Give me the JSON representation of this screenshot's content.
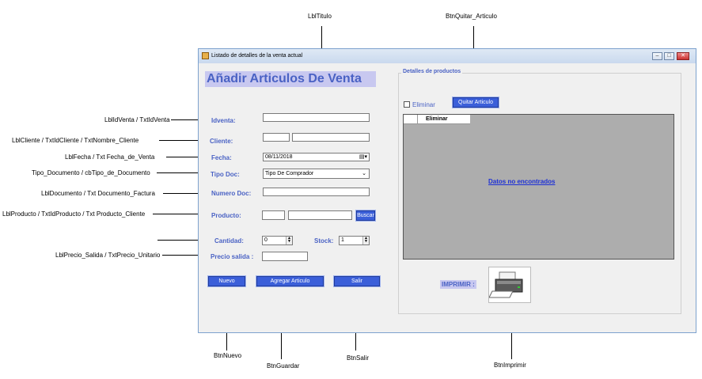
{
  "annotations": {
    "lbl_titulo": "LblTitulo",
    "btn_quitar_articulo": "BtnQuitar_Articulo",
    "idventa": "LblIdVenta / TxtIdVenta",
    "cliente": "LblCliente / TxtIdCliente / TxtNombre_Cliente",
    "fecha": "LblFecha / Txt Fecha_de_Venta",
    "tipo_documento": "Tipo_Documento / cbTipo_de_Documento",
    "documento": "LblDocumento / Txt Documento_Factura",
    "producto": "LblProducto / TxtIdProducto / Txt Producto_Cliente",
    "precio": "LblPrecio_Salida / TxtPrecio_Unitario",
    "btn_nuevo": "BtnNuevo",
    "btn_guardar": "BtnGuardar",
    "btn_salir": "BtnSalir",
    "btn_imprimir": "BtnImprimir"
  },
  "window": {
    "title": "Listado de detalles de la venta actual",
    "minimize_glyph": "–",
    "maximize_glyph": "□",
    "close_glyph": "✕"
  },
  "form": {
    "heading": "Añadir Articulos De Venta",
    "idventa_label": "Idventa:",
    "idventa_value": "",
    "cliente_label": "Cliente:",
    "cliente_id_value": "",
    "cliente_nombre_value": "",
    "fecha_label": "Fecha:",
    "fecha_value": "08/11/2018",
    "tipo_doc_label": "Tipo Doc:",
    "tipo_doc_value": "Tipo De Comprador",
    "numero_doc_label": "Numero Doc:",
    "numero_doc_value": "",
    "producto_label": "Producto:",
    "producto_id_value": "",
    "producto_nombre_value": "",
    "buscar_button": "Buscar",
    "cantidad_label": "Cantidad:",
    "cantidad_value": "0",
    "stock_label": "Stock:",
    "stock_value": "1",
    "precio_label": "Precio  salida :",
    "precio_value": "",
    "nuevo_button": "Nuevo",
    "agregar_button": "Agregar Articulo",
    "salir_button": "Salir"
  },
  "details": {
    "group_title": "Detalles de productos",
    "eliminar_checkbox": "Eliminar",
    "eliminar_checked": false,
    "quitar_button": "Quitar Articulo",
    "grid_columns": [
      "",
      "Eliminar"
    ],
    "empty_message": "Datos no encontrados",
    "imprimir_label": "IMPRIMIR :"
  },
  "colors": {
    "label_blue": "#4a62c4",
    "button_blue": "#3b5fd9",
    "heading_bg": "#c8c8f0",
    "grid_bg": "#adadad"
  }
}
